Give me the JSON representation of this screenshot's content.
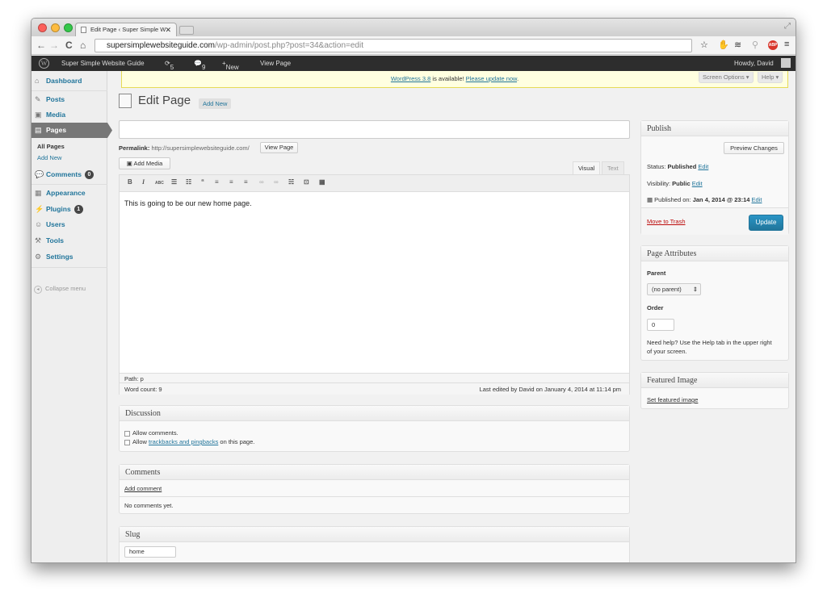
{
  "browser": {
    "tab_title": "Edit Page ‹ Super Simple W",
    "url_domain": "supersimplewebsiteguide.com",
    "url_path": "/wp-admin/post.php?post=34&action=edit"
  },
  "adminbar": {
    "site_name": "Super Simple Website Guide",
    "updates": "5",
    "comments": "9",
    "new_label": "New",
    "view_page": "View Page",
    "howdy": "Howdy, David"
  },
  "menu": {
    "dashboard": "Dashboard",
    "posts": "Posts",
    "media": "Media",
    "pages": "Pages",
    "all_pages": "All Pages",
    "add_new": "Add New",
    "comments": "Comments",
    "comments_count": "0",
    "appearance": "Appearance",
    "plugins": "Plugins",
    "plugins_count": "1",
    "users": "Users",
    "tools": "Tools",
    "settings": "Settings",
    "collapse": "Collapse menu"
  },
  "notice": {
    "link": "WordPress 3.8",
    "middle": " is available! ",
    "update_link": "Please update now",
    "end": "."
  },
  "screen_options": "Screen Options ▾",
  "help": "Help ▾",
  "page": {
    "heading": "Edit Page",
    "add_new": "Add New",
    "permalink_label": "Permalink:",
    "permalink_url": "http://supersimplewebsiteguide.com/",
    "view_page_btn": "View Page",
    "add_media": "Add Media",
    "tab_visual": "Visual",
    "tab_text": "Text",
    "content": "This is going to be our new home page.",
    "path": "Path: p",
    "word_count": "Word count: 9",
    "last_edited": "Last edited by David on January 4, 2014 at 11:14 pm"
  },
  "publish": {
    "title": "Publish",
    "preview": "Preview Changes",
    "status_label": "Status: ",
    "status_value": "Published",
    "visibility_label": "Visibility: ",
    "visibility_value": "Public",
    "published_label": "Published on: ",
    "published_value": "Jan 4, 2014 @ 23:14",
    "edit": "Edit",
    "trash": "Move to Trash",
    "update": "Update"
  },
  "attributes": {
    "title": "Page Attributes",
    "parent_label": "Parent",
    "parent_value": "(no parent)",
    "order_label": "Order",
    "order_value": "0",
    "help_line1": "Need help? Use the Help tab in the upper right",
    "help_line2": "of your screen."
  },
  "featured": {
    "title": "Featured Image",
    "link": "Set featured image"
  },
  "discussion": {
    "title": "Discussion",
    "allow_comments": "Allow comments.",
    "allow": "Allow ",
    "trackbacks_link": "trackbacks and pingbacks",
    "on_page": " on this page."
  },
  "comments_box": {
    "title": "Comments",
    "add": "Add comment",
    "none": "No comments yet."
  },
  "slug": {
    "title": "Slug",
    "value": "home"
  },
  "colors": {
    "link": "#21759b",
    "adminbar": "#2d2d2d",
    "menu_current": "#777777",
    "notice_bg": "#ffffe0"
  }
}
